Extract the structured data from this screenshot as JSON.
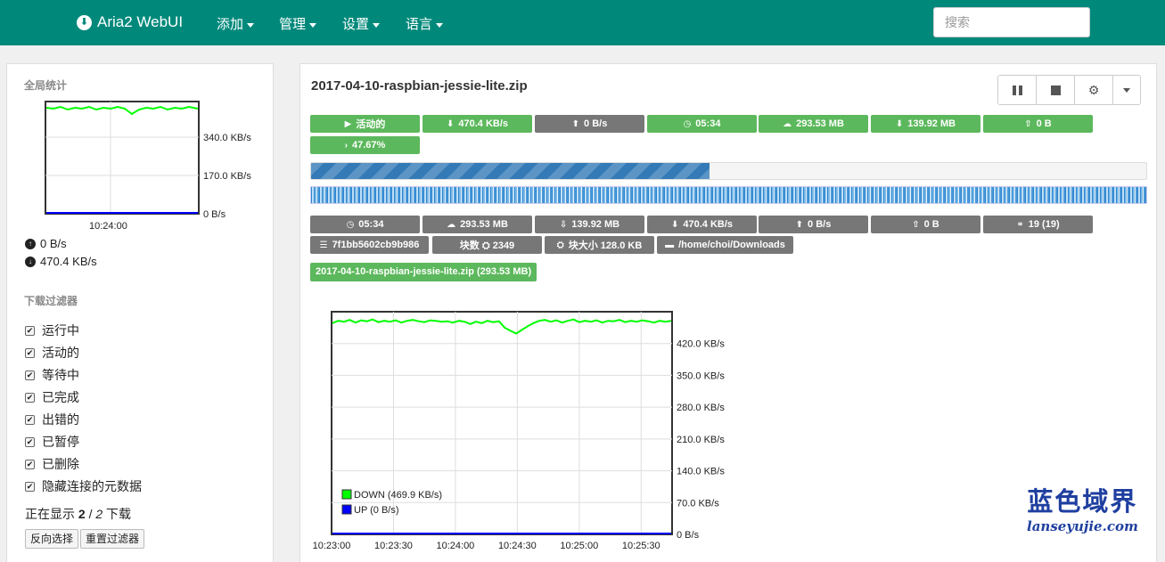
{
  "navbar": {
    "brand": "Aria2 WebUI",
    "menus": [
      "添加",
      "管理",
      "设置",
      "语言"
    ],
    "search_placeholder": "搜索"
  },
  "sidebar": {
    "stats_title": "全局统计",
    "mini_chart": {
      "y_ticks": [
        "340.0 KB/s",
        "170.0 KB/s",
        "0 B/s"
      ],
      "x_ticks": [
        "10:24:00"
      ]
    },
    "up_speed": "0 B/s",
    "down_speed": "470.4 KB/s",
    "filter_title": "下载过滤器",
    "filters": [
      "运行中",
      "活动的",
      "等待中",
      "已完成",
      "出错的",
      "已暂停",
      "已删除",
      "隐藏连接的元数据"
    ],
    "showing_prefix": "正在显示",
    "showing_count": "2",
    "showing_sep": "/",
    "showing_total": "2",
    "showing_suffix": "下载",
    "invert_button": "反向选择",
    "reset_button": "重置过滤器"
  },
  "download": {
    "name": "2017-04-10-raspbian-jessie-lite.zip",
    "status_badges": [
      {
        "icon": "▶",
        "text": "活动的"
      },
      {
        "icon": "⬇",
        "text": "470.4 KB/s"
      },
      {
        "icon": "⬆",
        "text": "0 B/s"
      },
      {
        "icon": "◷",
        "text": "05:34"
      },
      {
        "icon": "☁",
        "text": "293.53 MB"
      },
      {
        "icon": "⬇",
        "text": "139.92 MB"
      },
      {
        "icon": "⇧",
        "text": "0 B"
      },
      {
        "icon": "›",
        "text": "47.67%"
      }
    ],
    "progress": 47.67,
    "detail_badges": [
      {
        "icon": "◷",
        "text": "05:34"
      },
      {
        "icon": "☁",
        "text": "293.53 MB"
      },
      {
        "icon": "⇩",
        "text": "139.92 MB"
      },
      {
        "icon": "⬇",
        "text": "470.4 KB/s"
      },
      {
        "icon": "⬆",
        "text": "0 B/s"
      },
      {
        "icon": "⇧",
        "text": "0 B"
      },
      {
        "icon": "⚭",
        "text": "19 (19)"
      },
      {
        "icon": "☰",
        "text": "7f1bb5602cb9b986"
      },
      {
        "icon": "",
        "text": "块数 ⛭ 2349"
      },
      {
        "icon": "⛭",
        "text": "块大小 128.0 KB"
      },
      {
        "icon": "▬",
        "text": "/home/choi/Downloads"
      }
    ],
    "file_label": "2017-04-10-raspbian-jessie-lite.zip (293.53 MB)"
  },
  "chart_data": {
    "type": "line",
    "ylim": [
      0,
      490
    ],
    "y_ticks": [
      {
        "v": 420,
        "label": "420.0 KB/s"
      },
      {
        "v": 350,
        "label": "350.0 KB/s"
      },
      {
        "v": 280,
        "label": "280.0 KB/s"
      },
      {
        "v": 210,
        "label": "210.0 KB/s"
      },
      {
        "v": 140,
        "label": "140.0 KB/s"
      },
      {
        "v": 70,
        "label": "70.0 KB/s"
      },
      {
        "v": 0,
        "label": "0 B/s"
      }
    ],
    "x_ticks": [
      "10:23:00",
      "10:23:30",
      "10:24:00",
      "10:24:30",
      "10:25:00",
      "10:25:30"
    ],
    "series": [
      {
        "name": "DOWN (469.9 KB/s)",
        "color": "#00ff00",
        "values": [
          465,
          470,
          468,
          472,
          466,
          471,
          469,
          473,
          467,
          470,
          468,
          471,
          466,
          470,
          472,
          469,
          467,
          471,
          470,
          468,
          469,
          466,
          470,
          468,
          463,
          468,
          465,
          470,
          467,
          469,
          455,
          448,
          442,
          450,
          458,
          465,
          470,
          472,
          468,
          471,
          466,
          470,
          473,
          467,
          470,
          468,
          471,
          466,
          470,
          469,
          472,
          467,
          470,
          468,
          471,
          469,
          466,
          470,
          468,
          470
        ]
      },
      {
        "name": "UP (0 B/s)",
        "color": "#0000ff",
        "values": [
          0,
          0,
          0,
          0,
          0,
          0,
          0,
          0,
          0,
          0,
          0,
          0,
          0,
          0,
          0,
          0,
          0,
          0,
          0,
          0,
          0,
          0,
          0,
          0,
          0,
          0,
          0,
          0,
          0,
          0,
          0,
          0,
          0,
          0,
          0,
          0,
          0,
          0,
          0,
          0,
          0,
          0,
          0,
          0,
          0,
          0,
          0,
          0,
          0,
          0,
          0,
          0,
          0,
          0,
          0,
          0,
          0,
          0,
          0,
          0
        ]
      }
    ]
  },
  "watermark": {
    "line1": "蓝色域界",
    "line2": "lanseyujie.com"
  }
}
